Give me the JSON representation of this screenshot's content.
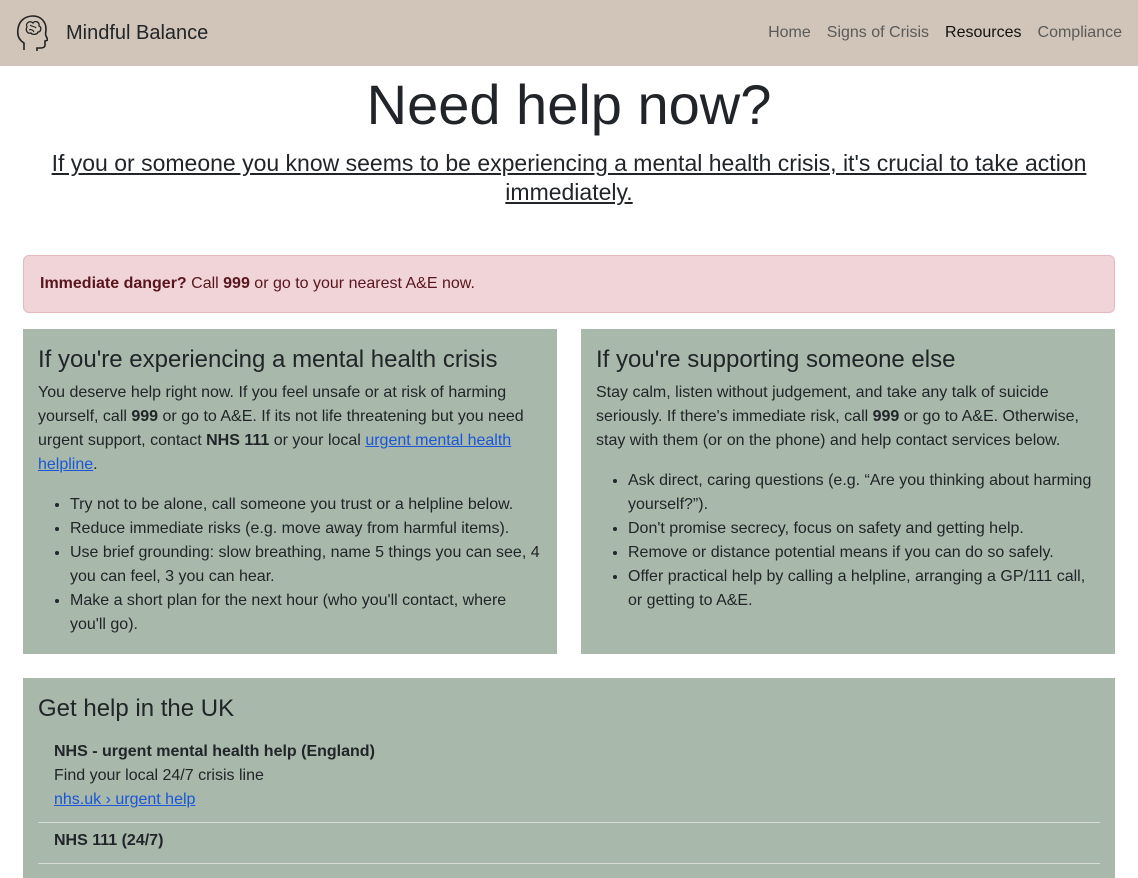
{
  "nav": {
    "brand": "Mindful Balance",
    "links": [
      {
        "label": "Home"
      },
      {
        "label": "Signs of Crisis"
      },
      {
        "label": "Resources"
      },
      {
        "label": "Compliance"
      }
    ],
    "active_link": "Resources"
  },
  "hero": {
    "title": "Need help now?",
    "subtitle": "If you or someone you know seems to be experiencing a mental health crisis, it's crucial to take action immediately."
  },
  "alert": {
    "lead": "Immediate danger?",
    "text_1": " Call ",
    "number": "999",
    "text_2": " or go to your nearest A&E now."
  },
  "self_card": {
    "heading": "If you're experiencing a mental health crisis",
    "p_1": "You deserve help right now. If you feel unsafe or at risk of harming yourself, call ",
    "number": "999",
    "p_2": " or go to A&E. If its not life threatening but you need urgent support, contact ",
    "nhs": "NHS 111",
    "p_3": " or your local ",
    "link": "urgent mental health helpline",
    "p_4": ".",
    "items": [
      "Try not to be alone, call someone you trust or a helpline below.",
      "Reduce immediate risks (e.g. move away from harmful items).",
      "Use brief grounding: slow breathing, name 5 things you can see, 4 you can feel, 3 you can hear.",
      "Make a short plan for the next hour (who you'll contact, where you'll go)."
    ]
  },
  "other_card": {
    "heading": "If you're supporting someone else",
    "p_1": "Stay calm, listen without judgement, and take any talk of suicide seriously. If there's immediate risk, call ",
    "number": "999",
    "p_2": " or go to A&E. Otherwise, stay with them (or on the phone) and help contact services below.",
    "items": [
      "Ask direct, caring questions (e.g. “Are you thinking about harming yourself?”).",
      "Don't promise secrecy, focus on safety and getting help.",
      "Remove or distance potential means if you can do so safely.",
      "Offer practical help by calling a helpline, arranging a GP/111 call, or getting to A&E."
    ]
  },
  "uk_card": {
    "heading": "Get help in the UK",
    "items": [
      {
        "name": "NHS - urgent mental health help (England)",
        "desc": "Find your local 24/7 crisis line",
        "link": "nhs.uk › urgent help"
      },
      {
        "name": "NHS 111 (24/7)",
        "desc": "",
        "link": ""
      }
    ]
  }
}
